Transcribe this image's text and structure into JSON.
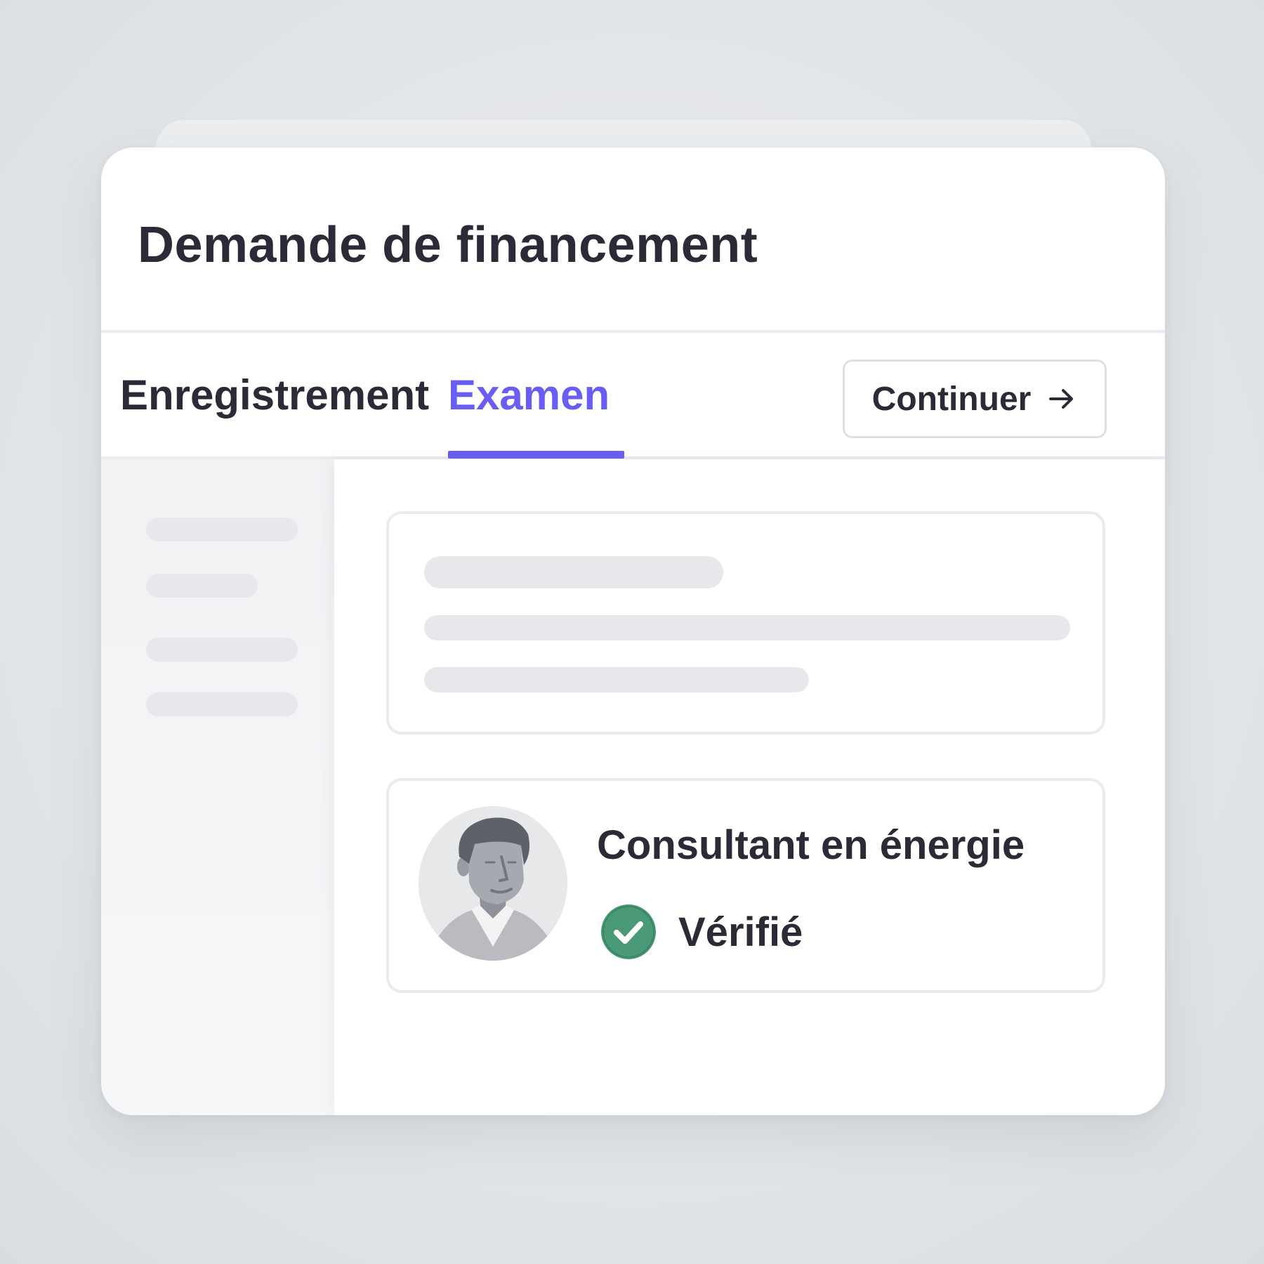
{
  "window": {
    "title": "Demande de financement"
  },
  "tabs": [
    {
      "label": "Enregistrement",
      "active": false
    },
    {
      "label": "Examen",
      "active": true
    }
  ],
  "toolbar": {
    "continue_label": "Continuer",
    "continue_icon": "arrow-right-icon"
  },
  "consultant": {
    "title": "Consultant en énergie",
    "status_label": "Vérifié",
    "status_icon": "check-circle-icon",
    "avatar": "avatar-icon"
  },
  "colors": {
    "accent": "#6a5ef2",
    "verified": "#4a9a78",
    "text": "#2b2b38",
    "skeleton": "#e6e8eb"
  }
}
